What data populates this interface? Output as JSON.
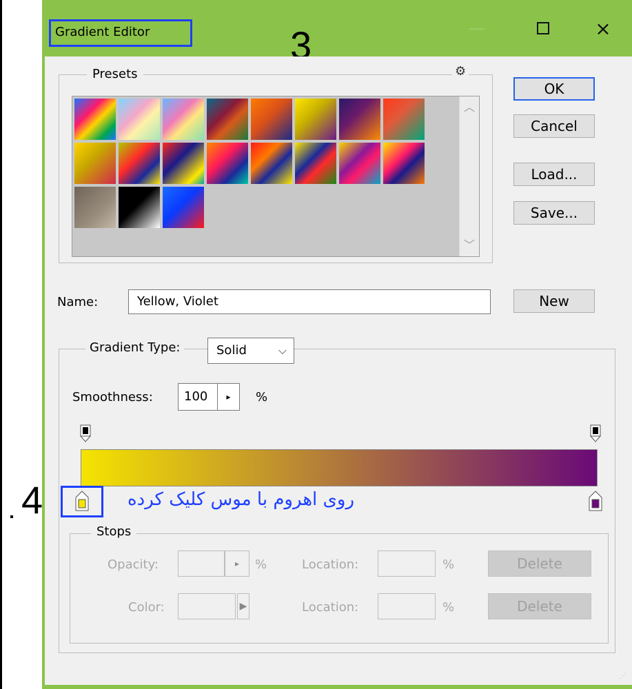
{
  "window": {
    "title": "Gradient Editor",
    "close_glyph": "×"
  },
  "annotations": {
    "step3": "3",
    "step4": "4",
    "note": "روی اهروم با موس کلیک کرده"
  },
  "presets": {
    "title": "Presets",
    "gear_glyph": "⚙",
    "swatches": [
      {
        "name": "preset-1",
        "css": "linear-gradient(135deg,#1e73ff 0%,#ff1a6b 35%,#ffd400 55%,#00a651 80%,#1e73ff 100%)"
      },
      {
        "name": "preset-2",
        "css": "linear-gradient(135deg,#7fd6ff 0%,#f4a7c8 40%,#fff2a8 60%,#a8e6b8 100%)"
      },
      {
        "name": "preset-3",
        "css": "linear-gradient(135deg,#6ab6ff 0%,#f07ab8 40%,#ffe680 60%,#86e0b0 100%)"
      },
      {
        "name": "preset-4",
        "css": "linear-gradient(135deg,#0b6a8a 0%,#8a1a3a 40%,#d65a1a 60%,#1a7a3a 100%)"
      },
      {
        "name": "preset-5",
        "css": "linear-gradient(135deg,#ff7a00 0%,#d9501a 45%,#1a2a8a 100%)"
      },
      {
        "name": "preset-6",
        "css": "linear-gradient(135deg,#ffe600 0%,#c8b000 40%,#6a1a8a 100%)"
      },
      {
        "name": "preset-7",
        "css": "linear-gradient(135deg,#2a1a6a 0%,#6a1a6a 40%,#ff8a00 100%)"
      },
      {
        "name": "preset-8",
        "css": "linear-gradient(135deg,#ff3a1a 0%,#e05a3a 40%,#00a67a 100%)"
      },
      {
        "name": "preset-9",
        "css": "linear-gradient(135deg,#ffd400 0%,#c8a800 40%,#d02a4a 100%)"
      },
      {
        "name": "preset-10",
        "css": "linear-gradient(135deg,#b0c800 0%,#ff2a2a 40%,#1a2a9a 70%,#ffe600 100%)"
      },
      {
        "name": "preset-11",
        "css": "linear-gradient(135deg,#ff2a1a 0%,#1a1a8a 40%,#ffe600 80%,#00a6a6 100%)"
      },
      {
        "name": "preset-12",
        "css": "linear-gradient(135deg,#ff8a00 0%,#ff1a5a 40%,#1a2a9a 70%,#00c8a8 100%)"
      },
      {
        "name": "preset-13",
        "css": "linear-gradient(135deg,#ff1a1a 0%,#ff7a00 35%,#1a2a9a 60%,#ffe600 100%)"
      },
      {
        "name": "preset-14",
        "css": "linear-gradient(135deg,#ffe600 0%,#1a2a9a 40%,#ff2a2a 60%,#1a8a1a 100%)"
      },
      {
        "name": "preset-15",
        "css": "linear-gradient(135deg,#ffd400 0%,#8a1a9a 40%,#ff1a6a 60%,#00a6c8 100%)"
      },
      {
        "name": "preset-16",
        "css": "linear-gradient(135deg,#ffe600 0%,#ff1a6a 40%,#1a1a8a 60%,#ff7a00 100%)"
      },
      {
        "name": "preset-17",
        "css": "linear-gradient(135deg,#6e6458 0%,#988c7c 60%,#c4b9a8 100%)"
      },
      {
        "name": "preset-18",
        "css": "linear-gradient(135deg,#000000 0%,#000000 45%,#ffffff 100%)"
      },
      {
        "name": "preset-19",
        "css": "linear-gradient(135deg,#1a6aff 0%,#0a3aff 45%,#ff1a1a 100%)"
      }
    ]
  },
  "buttons": {
    "ok": "OK",
    "cancel": "Cancel",
    "load": "Load...",
    "save": "Save...",
    "new": "New"
  },
  "name": {
    "label": "Name:",
    "value": "Yellow, Violet"
  },
  "gradient_type": {
    "label": "Gradient Type:",
    "value": "Solid"
  },
  "smoothness": {
    "label": "Smoothness:",
    "value": "100",
    "unit": "%"
  },
  "gradient": {
    "start_color": "#f5e400",
    "end_color": "#6a0a78"
  },
  "stops": {
    "title": "Stops",
    "opacity_label": "Opacity:",
    "opacity_unit": "%",
    "color_label": "Color:",
    "location_label": "Location:",
    "location_unit": "%",
    "delete_label": "Delete"
  }
}
